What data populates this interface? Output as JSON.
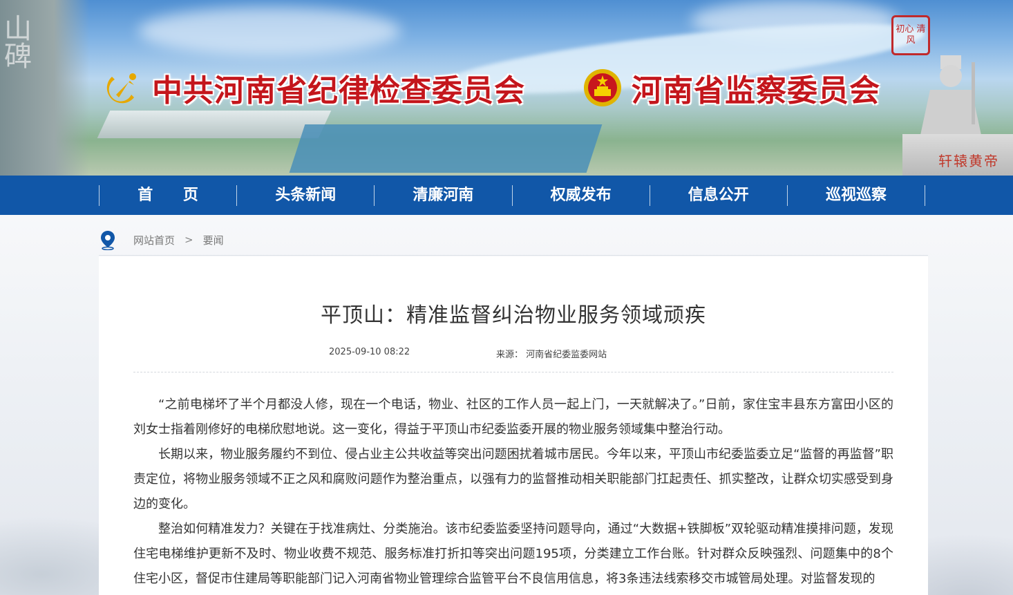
{
  "banner": {
    "cpc_title": "中共河南省纪律检查委员会",
    "gov_title": "河南省监察委员会",
    "seal_text": "初心 清风",
    "rock_text": "山碑",
    "statue_caption": "轩辕黄帝"
  },
  "nav": {
    "items": [
      "首 页",
      "头条新闻",
      "清廉河南",
      "权威发布",
      "信息公开",
      "巡视巡察"
    ]
  },
  "breadcrumb": {
    "home": "网站首页",
    "separator": ">",
    "current": "要闻"
  },
  "article": {
    "title": "平顶山：精准监督纠治物业服务领域顽疾",
    "date": "2025-09-10 08:22",
    "source": "来源： 河南省纪委监委网站",
    "paragraphs": [
      "“之前电梯坏了半个月都没人修，现在一个电话，物业、社区的工作人员一起上门，一天就解决了。”日前，家住宝丰县东方富田小区的刘女士指着刚修好的电梯欣慰地说。这一变化，得益于平顶山市纪委监委开展的物业服务领域集中整治行动。",
      "长期以来，物业服务履约不到位、侵占业主公共收益等突出问题困扰着城市居民。今年以来，平顶山市纪委监委立足“监督的再监督”职责定位，将物业服务领域不正之风和腐败问题作为整治重点，以强有力的监督推动相关职能部门扛起责任、抓实整改，让群众切实感受到身边的变化。",
      "整治如何精准发力？关键在于找准病灶、分类施治。该市纪委监委坚持问题导向，通过“大数据+铁脚板”双轮驱动精准摸排问题，发现住宅电梯维护更新不及时、物业收费不规范、服务标准打折扣等突出问题195项，分类建立工作台账。针对群众反映强烈、问题集中的8个住宅小区，督促市住建局等职能部门记入河南省物业管理综合监管平台不良信用信息，将3条违法线索移交市城管局处理。对监督发现的"
    ]
  },
  "colors": {
    "nav_bg": "#1157a8",
    "brand_red": "#c4161c"
  }
}
